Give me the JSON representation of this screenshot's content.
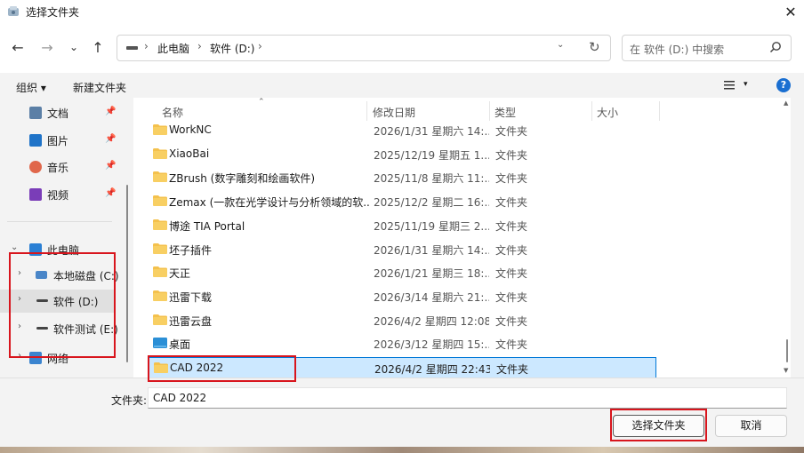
{
  "window": {
    "title": "选择文件夹",
    "close_glyph": "✕"
  },
  "nav": {
    "back": "←",
    "forward": "→",
    "recent": "⌄",
    "up": "↑"
  },
  "address": {
    "crumbs": [
      "此电脑",
      "软件 (D:)"
    ],
    "sep": "›",
    "dropdown": "⌄",
    "refresh": "↻"
  },
  "search": {
    "placeholder": "在 软件 (D:) 中搜索"
  },
  "toolbar": {
    "organize": "组织 ▾",
    "new_folder": "新建文件夹",
    "view_dd": "▾",
    "help": "?"
  },
  "sidebar": {
    "quick": [
      {
        "label": "文档",
        "icon": "document-icon",
        "color": "#5b7fa6"
      },
      {
        "label": "图片",
        "icon": "pictures-icon",
        "color": "#1f73c8"
      },
      {
        "label": "音乐",
        "icon": "music-icon",
        "color": "#e0674b"
      },
      {
        "label": "视频",
        "icon": "video-icon",
        "color": "#7a3db8"
      }
    ],
    "pin": "📌",
    "this_pc": "此电脑",
    "drives": [
      "本地磁盘 (C:)",
      "软件 (D:)",
      "软件测试 (E:)"
    ],
    "network": "网络",
    "expand": "›",
    "collapse": "⌄"
  },
  "columns": {
    "name": "名称",
    "date": "修改日期",
    "type": "类型",
    "size": "大小",
    "sort": "⌃"
  },
  "files": [
    {
      "name": "WorkNC",
      "date": "2026/1/31 星期六 14:...",
      "type": "文件夹"
    },
    {
      "name": "XiaoBai",
      "date": "2025/12/19 星期五 1...",
      "type": "文件夹"
    },
    {
      "name": "ZBrush (数字雕刻和绘画软件)",
      "date": "2025/11/8 星期六 11:...",
      "type": "文件夹"
    },
    {
      "name": "Zemax (一款在光学设计与分析领域的软...",
      "date": "2025/12/2 星期二 16:...",
      "type": "文件夹"
    },
    {
      "name": "博途 TIA Portal",
      "date": "2025/11/19 星期三 2...",
      "type": "文件夹"
    },
    {
      "name": "坯子插件",
      "date": "2026/1/31 星期六 14:...",
      "type": "文件夹"
    },
    {
      "name": "天正",
      "date": "2026/1/21 星期三 18:...",
      "type": "文件夹"
    },
    {
      "name": "迅雷下载",
      "date": "2026/3/14 星期六 21:...",
      "type": "文件夹"
    },
    {
      "name": "迅雷云盘",
      "date": "2026/4/2 星期四 12:08",
      "type": "文件夹"
    },
    {
      "name": "桌面",
      "date": "2026/3/12 星期四 15:...",
      "type": "文件夹"
    },
    {
      "name": "CAD 2022",
      "date": "2026/4/2 星期四 22:43",
      "type": "文件夹"
    }
  ],
  "footer": {
    "folder_label": "文件夹:",
    "folder_value": "CAD 2022",
    "select_btn": "选择文件夹",
    "cancel_btn": "取消"
  },
  "colors": {
    "folder": "#f4c14d",
    "highlight": "#d8151d",
    "selection_bg": "#cce8ff",
    "selection_border": "#0078d7",
    "help": "#1a6fd1"
  }
}
